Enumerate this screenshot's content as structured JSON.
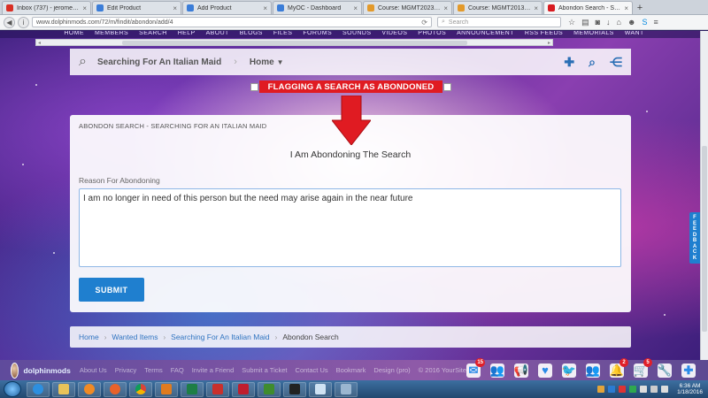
{
  "browser": {
    "tabs": [
      {
        "label": "Inbox (737) - jeromemi...",
        "color": "#d93025",
        "active": false
      },
      {
        "label": "Edit Product",
        "color": "#3b7dd8",
        "active": false
      },
      {
        "label": "Add Product",
        "color": "#3b7dd8",
        "active": false
      },
      {
        "label": "MyOC - Dashboard",
        "color": "#3b7dd8",
        "active": false
      },
      {
        "label": "Course: MGMT2023 Fin...",
        "color": "#e39a2b",
        "active": false
      },
      {
        "label": "Course: MGMT2013 Intr...",
        "color": "#e39a2b",
        "active": false
      },
      {
        "label": "Abondon Search - Sear...",
        "color": "#d81b20",
        "active": true
      }
    ],
    "url": "www.dolphinmods.com/72/m/findit/abondon/add/4",
    "search_placeholder": "Search"
  },
  "site": {
    "top_menu": [
      "HOME",
      "MEMBERS",
      "SEARCH",
      "HELP",
      "ABOUT",
      "BLOGS",
      "FILES",
      "FORUMS",
      "SOUNDS",
      "VIDEOS",
      "PHOTOS",
      "ANNOUNCEMENT",
      "RSS FEEDS",
      "MEMORIALS",
      "WANT"
    ],
    "subheader": {
      "title": "Searching For An Italian Maid",
      "home_label": "Home"
    },
    "flag_banner": "FLAGGING A SEARCH AS ABONDONED",
    "form": {
      "section_title": "ABONDON SEARCH - SEARCHING FOR AN ITALIAN MAID",
      "heading": "I Am Abondoning The Search",
      "reason_label": "Reason For Abondoning",
      "reason_value": "I am no longer in need of this person but the need may arise again in the near future",
      "submit_label": "SUBMIT"
    },
    "breadcrumb": {
      "items": [
        "Home",
        "Wanted Items",
        "Searching For An Italian Maid"
      ],
      "current": "Abondon Search"
    },
    "feedback_label": "FEEDBACK"
  },
  "footer": {
    "username": "dolphinmods",
    "links": [
      "About Us",
      "Privacy",
      "Terms",
      "FAQ",
      "Invite a Friend",
      "Submit a Ticket",
      "Contact Us",
      "Bookmark",
      "Design (pro)",
      "© 2016 YourSite"
    ],
    "badges": {
      "messages": "15",
      "notifications": "2",
      "cart": "5"
    }
  },
  "taskbar": {
    "time": "6:36 AM",
    "date": "1/18/2016"
  }
}
